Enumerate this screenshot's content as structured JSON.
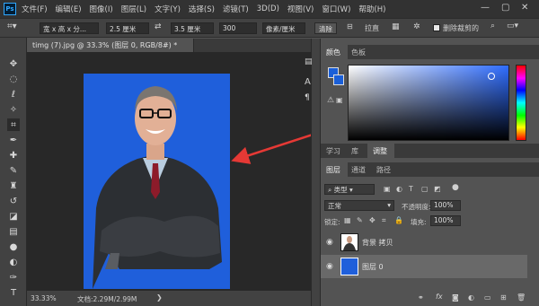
{
  "app": {
    "logo": "Ps"
  },
  "menu": [
    "文件(F)",
    "编辑(E)",
    "图像(I)",
    "图层(L)",
    "文字(Y)",
    "选择(S)",
    "滤镜(T)",
    "3D(D)",
    "视图(V)",
    "窗口(W)",
    "帮助(H)"
  ],
  "window_controls": {
    "minimize": "—",
    "maximize": "▢",
    "close": "✕"
  },
  "options": {
    "mode": "宽 x 高 x 分...",
    "width": "2.5 厘米",
    "swap": "⇄",
    "height": "3.5 厘米",
    "resolution": "300",
    "unit": "像素/厘米",
    "clear": "清除",
    "straighten": "拉直",
    "delete_cropped": "删除裁剪的"
  },
  "document": {
    "tab_title": "timg (7).jpg @ 33.3% (图层 0, RGB/8#) *",
    "zoom": "33.33%",
    "doc_size": "文档:2.29M/2.99M",
    "canvas_color": "#1f5fdb"
  },
  "color_panel": {
    "tabs": [
      "颜色",
      "色板"
    ],
    "foreground": "#1a5fd8",
    "background": "#1a5fd8"
  },
  "mid_tabs": [
    "学习",
    "库",
    "调整"
  ],
  "layers_panel": {
    "tabs": [
      "图层",
      "通道",
      "路径"
    ],
    "filter_kind": "类型",
    "blend_mode": "正常",
    "opacity_label": "不透明度:",
    "opacity": "100%",
    "lock_label": "锁定:",
    "fill_label": "填充:",
    "fill": "100%",
    "layers": [
      {
        "name": "背景 拷贝",
        "selected": false
      },
      {
        "name": "图层 0",
        "selected": true
      }
    ],
    "footer_icons": [
      "link-icon",
      "fx-icon",
      "mask-icon",
      "adjustment-icon",
      "group-icon",
      "new-layer-icon",
      "trash-icon"
    ]
  },
  "toolbar": [
    "move",
    "marquee",
    "lasso",
    "magic-wand",
    "crop",
    "eyedropper",
    "healing",
    "brush",
    "stamp",
    "history-brush",
    "eraser",
    "gradient",
    "blur",
    "dodge",
    "pen",
    "type",
    "path-select"
  ]
}
